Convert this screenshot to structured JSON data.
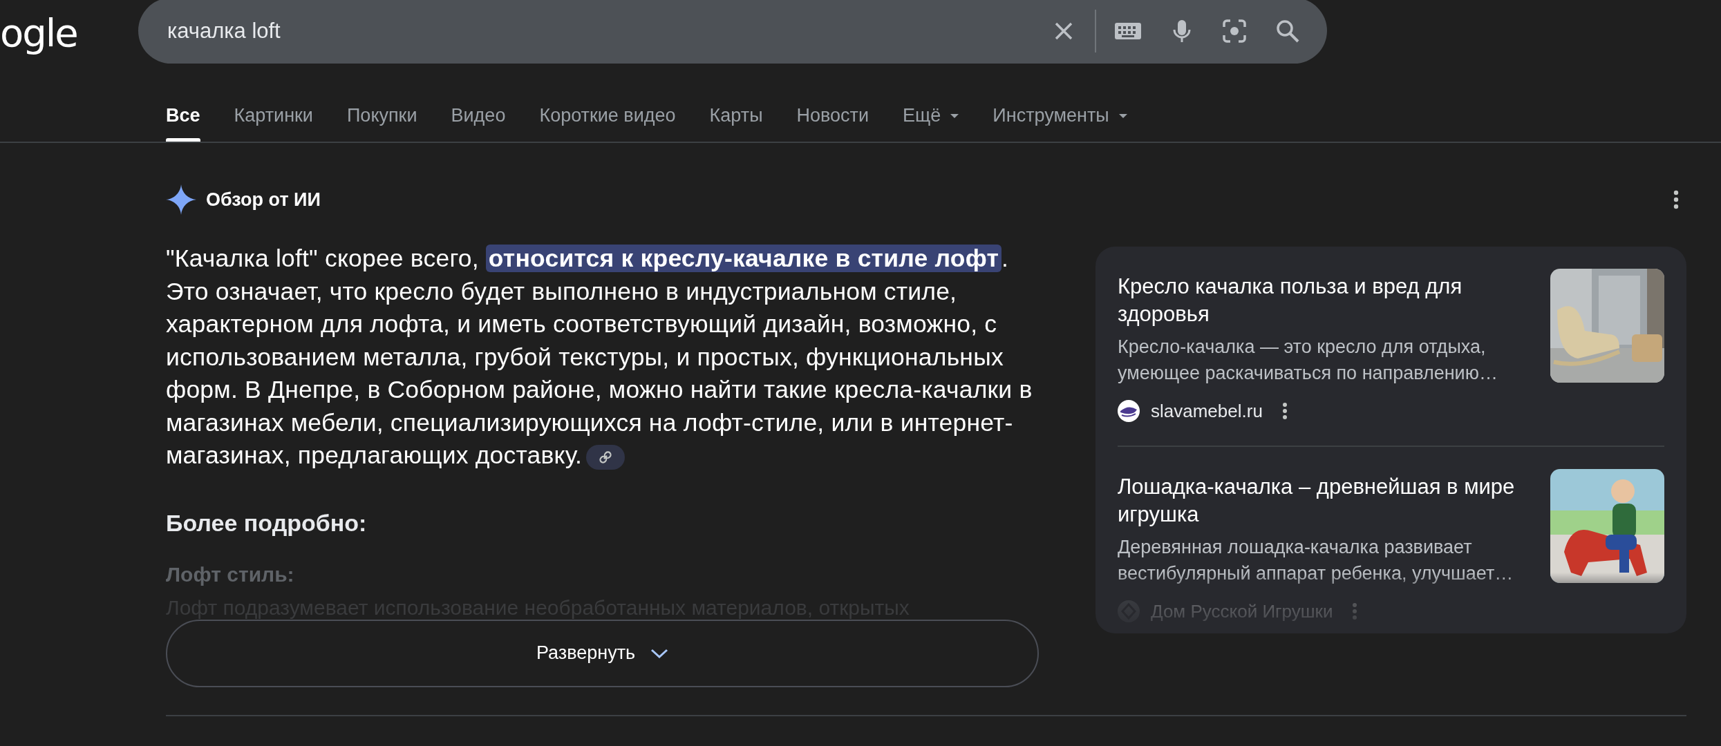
{
  "logo": {
    "text": "ogle"
  },
  "search": {
    "value": "качалка loft"
  },
  "tabs": [
    {
      "label": "Все",
      "selected": true,
      "kind": "plain"
    },
    {
      "label": "Картинки",
      "selected": false,
      "kind": "plain"
    },
    {
      "label": "Покупки",
      "selected": false,
      "kind": "plain"
    },
    {
      "label": "Видео",
      "selected": false,
      "kind": "plain"
    },
    {
      "label": "Короткие видео",
      "selected": false,
      "kind": "plain"
    },
    {
      "label": "Карты",
      "selected": false,
      "kind": "plain"
    },
    {
      "label": "Новости",
      "selected": false,
      "kind": "plain"
    },
    {
      "label": "Ещё",
      "selected": false,
      "kind": "menu"
    }
  ],
  "tools": {
    "label": "Инструменты"
  },
  "ai_overview": {
    "title": "Обзор от ИИ",
    "paragraph": "\"Качалка loft\" скорее всего, **относится к креслу-качалке в стиле лофт**. Это означает, что кресло будет выполнено в индустриальном стиле, характерном для лофта, и иметь соответствующий дизайн, возможно, с использованием металла, грубой текстуры, и простых, функциональных форм. В Днепре, в Соборном районе, можно найти такие кресла-качалки в магазинах мебели, специализирующихся на лофт-стиле, или в интернет-магазинах, предлагающих доставку.",
    "more_heading": "Более подробно:",
    "section_heading": "Лофт стиль:",
    "section_text": "Лофт подразумевает использование необработанных материалов, открытых",
    "expand_button": "Развернуть"
  },
  "sources": [
    {
      "title": "Кресло качалка польза и вред для здоровья",
      "snippet": "Кресло-качалка — это кресло для отдыха, умеющее раскачиваться по направлению…",
      "site": "slavamebel.ru"
    },
    {
      "title": "Лошадка-качалка – древнейшая в мире игрушка",
      "snippet": "Деревянная лошадка-качалка развивает вестибулярный аппарат ребенка, улучшает…",
      "site": "Дом Русской Игрушки"
    }
  ]
}
